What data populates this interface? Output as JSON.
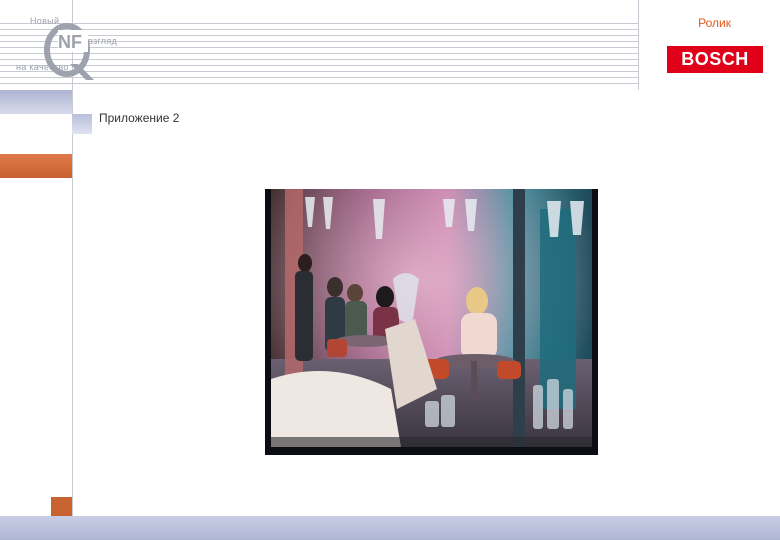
{
  "logo": {
    "word_top": "Новый",
    "word_mid": "взгляд",
    "word_bottom": "на качество"
  },
  "header": {
    "title": "Ролик",
    "brand": "BOSCH"
  },
  "content": {
    "caption": "Приложение 2"
  },
  "colors": {
    "accent_orange": "#e05a1e",
    "brand_red": "#e1001a",
    "band_blue": "#aeb4d2",
    "sidebar_orange": "#c9602f"
  }
}
